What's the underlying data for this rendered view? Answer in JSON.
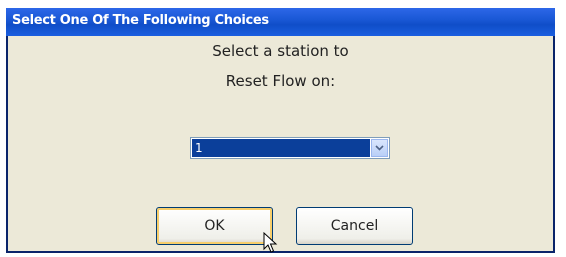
{
  "dialog": {
    "title": "Select One Of The Following Choices",
    "prompt_line1": "Select a station to",
    "prompt_line2": "Reset Flow on:",
    "station_select": {
      "selected_value": "1"
    },
    "ok_label": "OK",
    "cancel_label": "Cancel"
  },
  "colors": {
    "titlebar": "#1a58d6",
    "dialog_background": "#ece9d8",
    "selection_highlight": "#0b3f9a"
  },
  "icons": {
    "dropdown": "chevron-down-icon",
    "cursor": "mouse-pointer-icon"
  }
}
